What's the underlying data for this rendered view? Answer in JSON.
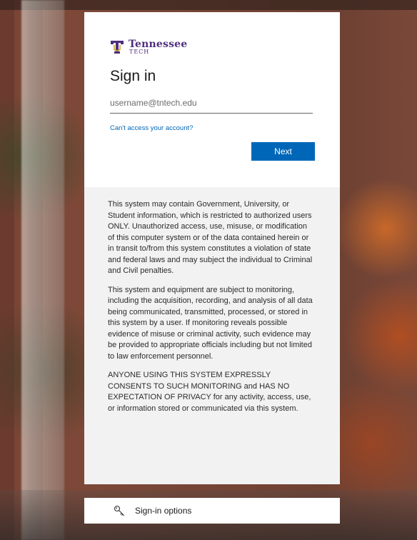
{
  "brand": {
    "name": "Tennessee",
    "sub": "TECH",
    "color": "#4f2d7f"
  },
  "signin": {
    "title": "Sign in",
    "username_placeholder": "username@tntech.edu",
    "username_value": "",
    "cant_access_link": "Can't access your account?",
    "next_label": "Next",
    "accent_color": "#0067b8"
  },
  "notice": {
    "paragraphs": [
      "This system may contain Government, University, or Student information, which is restricted to authorized users ONLY. Unauthorized access, use, misuse, or modification of this computer system or of the data contained herein or in transit to/from this system constitutes a violation of state and federal laws and may subject the individual to Criminal and Civil penalties.",
      "This system and equipment are subject to monitoring, including the acquisition, recording, and analysis of all data being communicated, transmitted, processed, or stored in this system by a user. If monitoring reveals possible evidence of misuse or criminal activity, such evidence may be provided to appropriate officials including but not limited to law enforcement personnel.",
      "ANYONE USING THIS SYSTEM EXPRESSLY CONSENTS TO SUCH MONITORING and HAS NO EXPECTATION OF PRIVACY for any activity, access, use, or information stored or communicated via this system."
    ]
  },
  "signin_options": {
    "label": "Sign-in options",
    "icon": "key-icon"
  }
}
